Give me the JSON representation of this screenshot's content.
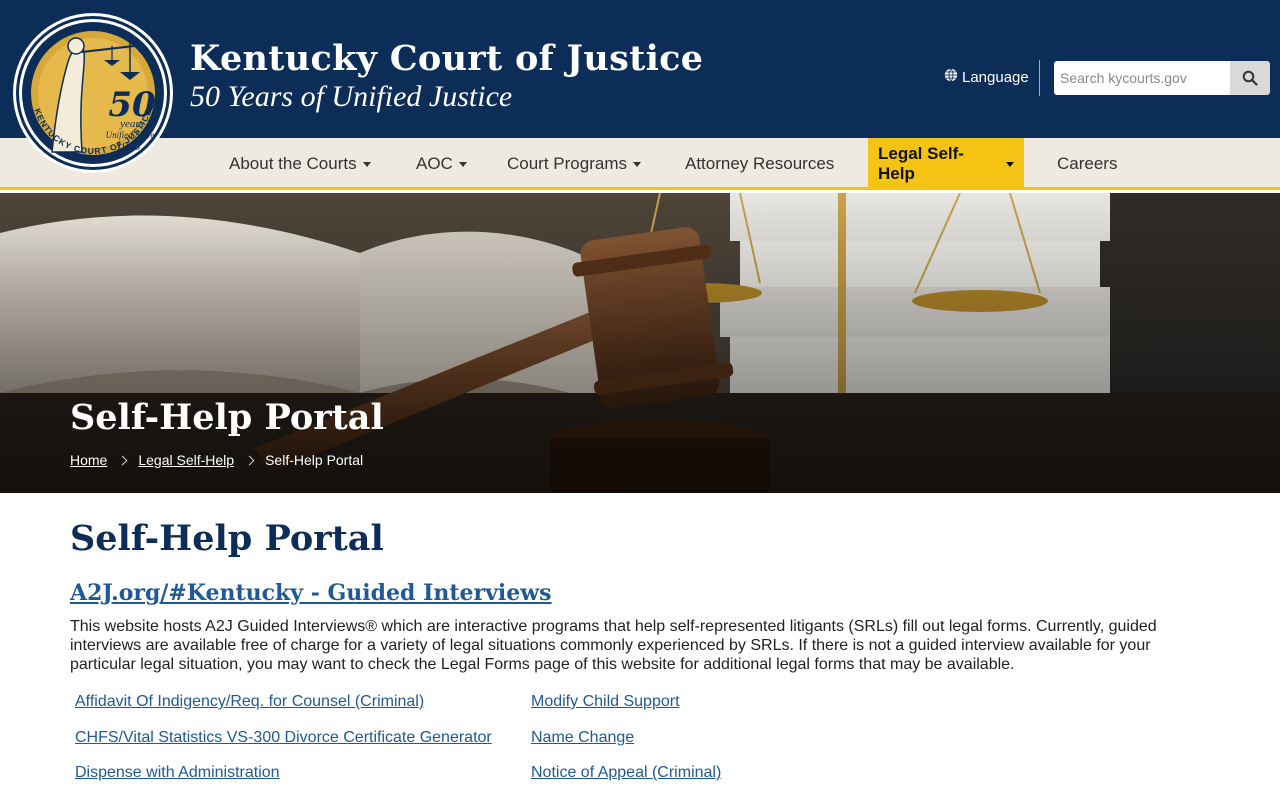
{
  "header": {
    "title": "Kentucky Court of Justice",
    "subtitle": "50 Years of Unified Justice",
    "seal": {
      "number": "50",
      "years": "years",
      "unified_since": "Unified Since",
      "year": "1976",
      "ring_text": "KENTUCKY COURT OF JUSTICE"
    },
    "language_label": "Language",
    "search_placeholder": "Search kycourts.gov"
  },
  "nav": {
    "items": [
      {
        "label": "About the Courts",
        "dropdown": true
      },
      {
        "label": "AOC",
        "dropdown": true
      },
      {
        "label": "Court Programs",
        "dropdown": true
      },
      {
        "label": "Attorney Resources",
        "dropdown": false
      },
      {
        "label": "Legal Self-Help",
        "dropdown": true,
        "active": true
      },
      {
        "label": "Careers",
        "dropdown": false
      }
    ]
  },
  "hero": {
    "title": "Self-Help Portal",
    "breadcrumb": [
      "Home",
      "Legal Self-Help",
      "Self-Help Portal"
    ]
  },
  "main": {
    "title": "Self-Help Portal",
    "section_link": "A2J.org/#Kentucky - Guided Interviews",
    "intro": "This website hosts A2J Guided Interviews® which are interactive programs that help self-represented litigants (SRLs) fill out legal forms. Currently, guided interviews are available free of charge for a variety of legal situations commonly experienced by SRLs. If there is not a guided interview available for your particular legal situation, you may want to check the Legal Forms page of this website for additional legal forms that may be available.",
    "links_left": [
      "Affidavit Of Indigency/Req. for Counsel (Criminal)",
      "CHFS/Vital Statistics VS-300 Divorce Certificate Generator",
      "Dispense with Administration"
    ],
    "links_right": [
      "Modify Child Support",
      "Name Change",
      "Notice of Appeal (Criminal)"
    ]
  },
  "colors": {
    "header_bg": "#0c2d57",
    "nav_bg": "#efeae0",
    "accent_gold": "#f4c314",
    "link": "#1f5a96"
  },
  "icons": [
    "globe-icon",
    "search-icon",
    "caret-down-icon",
    "chevron-right-icon"
  ]
}
